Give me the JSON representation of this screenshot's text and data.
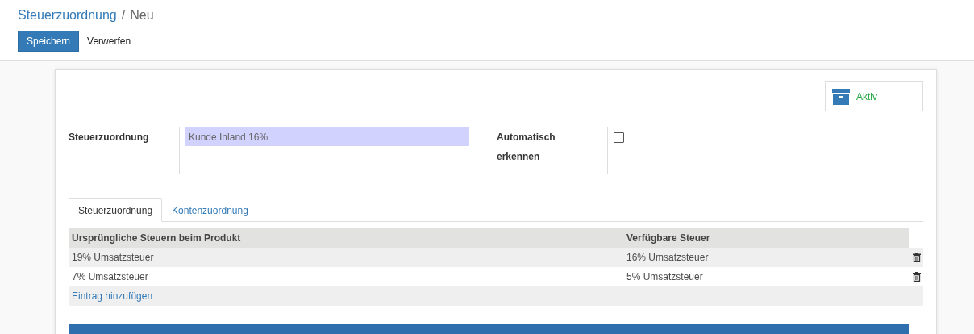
{
  "breadcrumb": {
    "parent": "Steuerzuordnung",
    "separator": "/",
    "current": "Neu"
  },
  "buttons": [
    {
      "label": "Speichern",
      "kind": "primary"
    },
    {
      "label": "Verwerfen",
      "kind": "link"
    }
  ],
  "status_button": {
    "label": "Aktiv"
  },
  "fields": [
    {
      "label": "Steuerzuordnung",
      "kind": "text",
      "value": "Kunde Inland 16%"
    },
    {
      "label": "Automatisch erkennen",
      "kind": "checkbox",
      "checked": false
    }
  ],
  "tabs": [
    {
      "label": "Steuerzuordnung",
      "selected": true
    },
    {
      "label": "Kontenzuordnung",
      "selected": false
    }
  ],
  "table": {
    "columns": [
      "Ursprüngliche Steuern beim Produkt",
      "Verfügbare Steuer"
    ],
    "rows": [
      [
        "19% Umsatzsteuer",
        "16% Umsatzsteuer"
      ],
      [
        "7% Umsatzsteuer",
        "5% Umsatzsteuer"
      ]
    ],
    "add_link": "Eintrag hinzufügen"
  }
}
